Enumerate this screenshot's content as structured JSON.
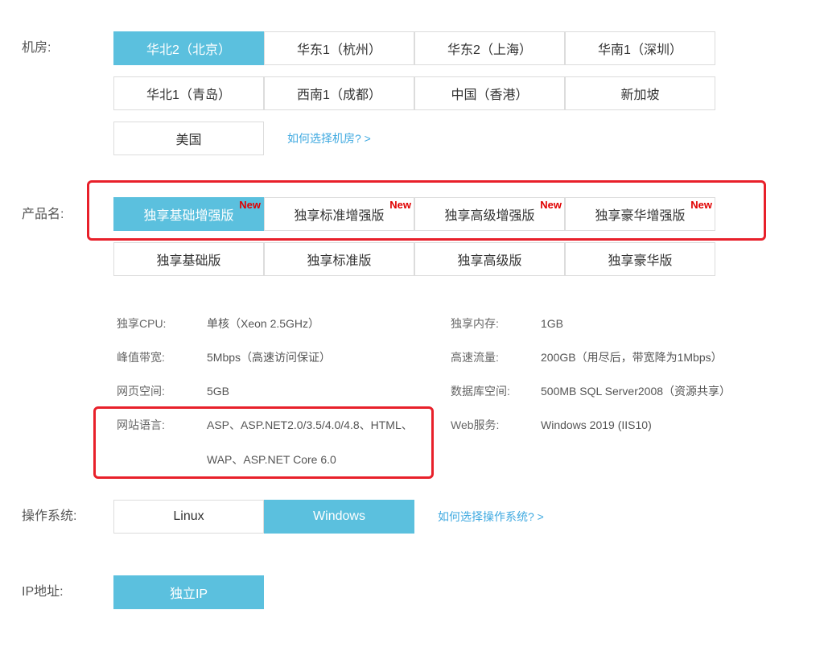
{
  "datacenter": {
    "label": "机房:",
    "options": [
      "华北2（北京）",
      "华东1（杭州）",
      "华东2（上海）",
      "华南1（深圳）",
      "华北1（青岛）",
      "西南1（成都）",
      "中国（香港）",
      "新加坡",
      "美国"
    ],
    "selected": "华北2（北京）",
    "help_link": "如何选择机房? >"
  },
  "product": {
    "label": "产品名:",
    "options": [
      "独享基础增强版",
      "独享标准增强版",
      "独享高级增强版",
      "独享豪华增强版",
      "独享基础版",
      "独享标准版",
      "独享高级版",
      "独享豪华版"
    ],
    "new_badge": "New",
    "selected": "独享基础增强版"
  },
  "specs": {
    "cpu": {
      "key": "独享CPU:",
      "value": "单核（Xeon 2.5GHz）"
    },
    "memory": {
      "key": "独享内存:",
      "value": "1GB"
    },
    "bandwidth": {
      "key": "峰值带宽:",
      "value": "5Mbps（高速访问保证）"
    },
    "traffic": {
      "key": "高速流量:",
      "value": "200GB（用尽后，带宽降为1Mbps）"
    },
    "webspace": {
      "key": "网页空间:",
      "value": "5GB"
    },
    "database": {
      "key": "数据库空间:",
      "value": "500MB SQL Server2008（资源共享）"
    },
    "languages": {
      "key": "网站语言:",
      "value_line1": "ASP、ASP.NET2.0/3.5/4.0/4.8、HTML、",
      "value_line2": "WAP、ASP.NET Core 6.0"
    },
    "webservice": {
      "key": "Web服务:",
      "value": "Windows 2019 (IIS10)"
    }
  },
  "os": {
    "label": "操作系统:",
    "options": [
      "Linux",
      "Windows"
    ],
    "selected": "Windows",
    "help_link": "如何选择操作系统? >"
  },
  "ip": {
    "label": "IP地址:",
    "options": [
      "独立IP"
    ],
    "selected": "独立IP"
  },
  "colors": {
    "accent": "#5bc0de",
    "link": "#3fa9e0",
    "badge": "#e00000",
    "highlight_box": "#e8202a"
  }
}
